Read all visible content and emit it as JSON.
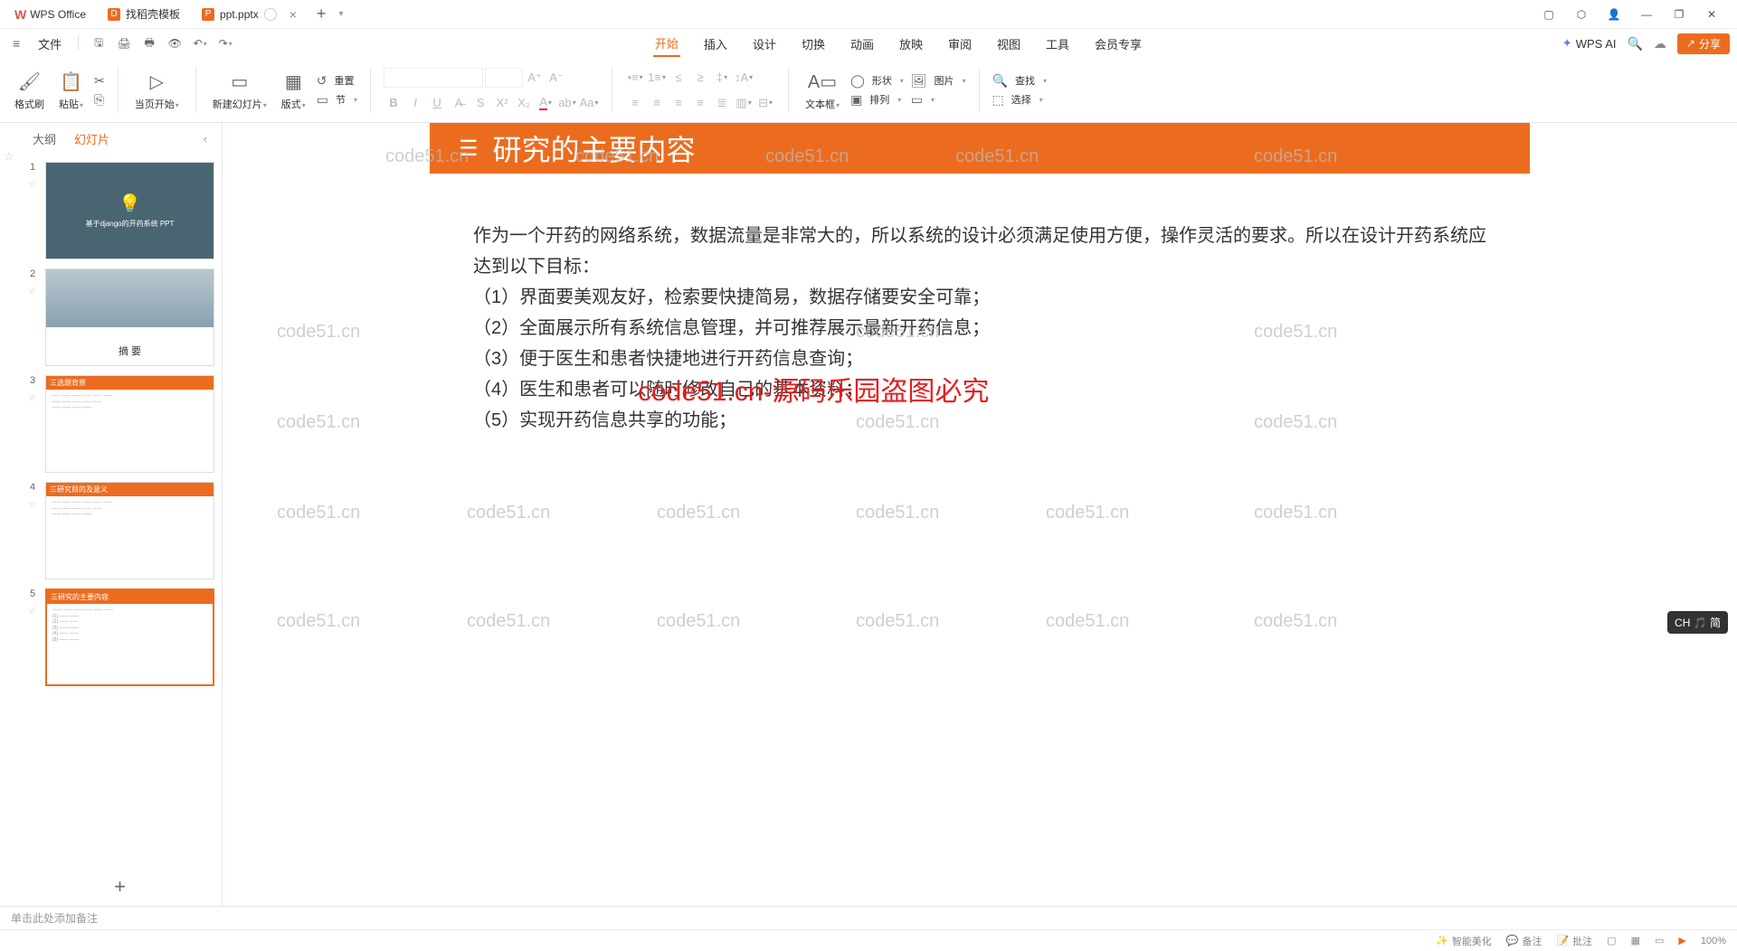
{
  "titlebar": {
    "app_name": "WPS Office",
    "tabs": [
      {
        "icon": "orange",
        "label": "找稻壳模板"
      },
      {
        "icon": "p",
        "label": "ppt.pptx",
        "active": true
      }
    ]
  },
  "menubar": {
    "file": "文件",
    "items": [
      "开始",
      "插入",
      "设计",
      "切换",
      "动画",
      "放映",
      "审阅",
      "视图",
      "工具",
      "会员专享"
    ],
    "active_index": 0,
    "wps_ai": "WPS AI",
    "share": "分享"
  },
  "ribbon": {
    "format_painter": "格式刷",
    "paste": "粘贴",
    "from_current": "当页开始",
    "new_slide": "新建幻灯片",
    "layout": "版式",
    "reset": "重置",
    "section": "节",
    "shape": "形状",
    "picture": "图片",
    "textbox": "文本框",
    "arrange": "排列",
    "find": "查找",
    "select": "选择"
  },
  "sidebar": {
    "tab_outline": "大纲",
    "tab_slides": "幻灯片",
    "slides": [
      {
        "num": "1",
        "title": "基于django的开药系统 PPT"
      },
      {
        "num": "2",
        "title": "摘    要"
      },
      {
        "num": "3",
        "header": "三选题背景"
      },
      {
        "num": "4",
        "header": "三研究目的及意义"
      },
      {
        "num": "5",
        "header": "三研究的主要内容"
      }
    ]
  },
  "slide": {
    "header_title": "研究的主要内容",
    "body_intro": "作为一个开药的网络系统，数据流量是非常大的，所以系统的设计必须满足使用方便，操作灵活的要求。所以在设计开药系统应达到以下目标：",
    "body_items": [
      "（1）界面要美观友好，检索要快捷简易，数据存储要安全可靠；",
      "（2）全面展示所有系统信息管理，并可推荐展示最新开药信息；",
      "（3）便于医生和患者快捷地进行开药信息查询；",
      "（4）医生和患者可以随时修改自己的基本资料；",
      "（5）实现开药信息共享的功能；"
    ],
    "watermark_main": "code51.cn-源码乐园盗图必究",
    "watermark_small": "code51.cn"
  },
  "notes": {
    "placeholder": "单击此处添加备注"
  },
  "statusbar": {
    "smart_beautify": "智能美化",
    "remarks": "备注",
    "comments": "批注",
    "zoom": "100%"
  },
  "ime_badge": "CH 🎵 简"
}
